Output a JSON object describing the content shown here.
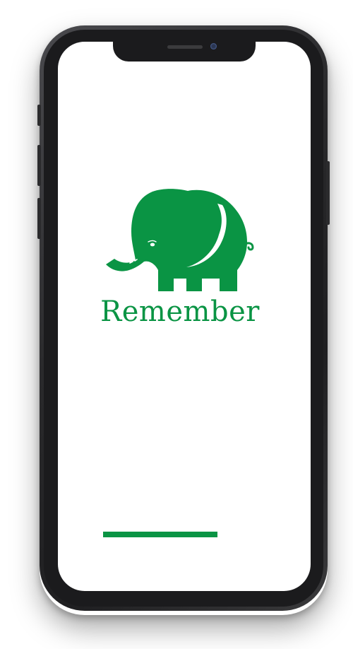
{
  "app": {
    "brand_name": "Remember",
    "logo_icon": "elephant-icon",
    "brand_color": "#0a9444"
  },
  "loading": {
    "progress": 1.0
  },
  "device": {
    "frame_color": "#1b1b1d"
  }
}
